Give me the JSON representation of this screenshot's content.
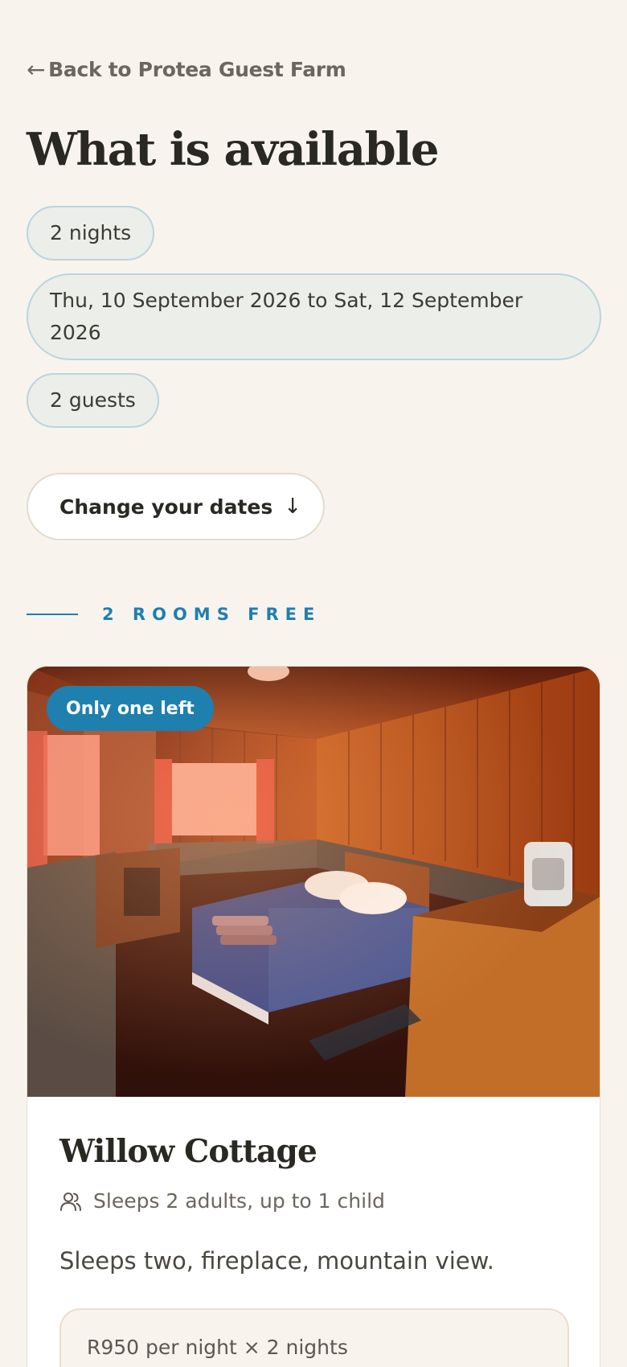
{
  "nav": {
    "back_arrow": "←",
    "back_label": "Back to Protea Guest Farm"
  },
  "header": {
    "title": "What is available"
  },
  "stay": {
    "nights": "2 nights",
    "dates": "Thu, 10 September 2026 to Sat, 12 September 2026",
    "guests": "2 guests"
  },
  "actions": {
    "change_dates_label": "Change your dates",
    "change_dates_icon": "↓"
  },
  "availability": {
    "label": "2 ROOMS FREE"
  },
  "rooms": [
    {
      "badge": "Only one left",
      "name": "Willow Cottage",
      "sleeps": "Sleeps 2 adults, up to 1 child",
      "description": "Sleeps two, fireplace, mountain view.",
      "price_line": "R950 per night × 2 nights"
    }
  ],
  "colors": {
    "accent": "#1f7fae",
    "background": "#f8f4ed",
    "chip_border": "#b9d5de",
    "text": "#2a2823"
  },
  "icons": {
    "back": "arrow-left-icon",
    "change": "arrow-down-icon",
    "guests": "users-icon"
  }
}
